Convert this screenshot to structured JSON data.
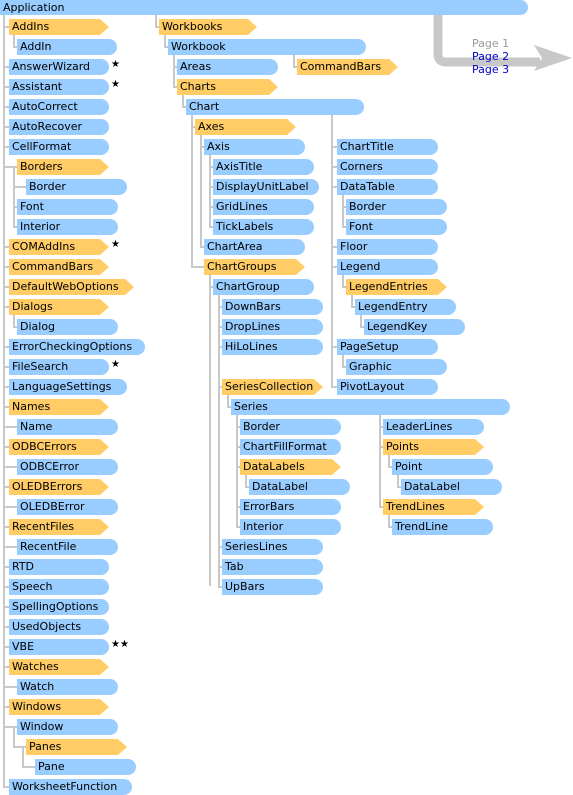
{
  "diagram": {
    "root": "Application",
    "colors": {
      "object": "#99ccff",
      "collection": "#ffcc66",
      "connector": "#c8c8c8",
      "link": "#0000cc",
      "current_page": "#999999"
    },
    "legend_markers": {
      "star": "★",
      "double_star": "★★"
    },
    "nodes": [
      {
        "id": "addins",
        "label": "AddIns",
        "type": "collection"
      },
      {
        "id": "addin",
        "label": "AddIn",
        "type": "object"
      },
      {
        "id": "answerwizard",
        "label": "AnswerWizard",
        "type": "object",
        "marker": "★"
      },
      {
        "id": "assistant",
        "label": "Assistant",
        "type": "object",
        "marker": "★"
      },
      {
        "id": "autocorrect",
        "label": "AutoCorrect",
        "type": "object"
      },
      {
        "id": "autorecover",
        "label": "AutoRecover",
        "type": "object"
      },
      {
        "id": "cellformat",
        "label": "CellFormat",
        "type": "object"
      },
      {
        "id": "cf-borders",
        "label": "Borders",
        "type": "collection"
      },
      {
        "id": "cf-border",
        "label": "Border",
        "type": "object"
      },
      {
        "id": "cf-font",
        "label": "Font",
        "type": "object"
      },
      {
        "id": "cf-interior",
        "label": "Interior",
        "type": "object"
      },
      {
        "id": "comaddins",
        "label": "COMAddIns",
        "type": "collection",
        "marker": "★"
      },
      {
        "id": "commandbars",
        "label": "CommandBars",
        "type": "collection"
      },
      {
        "id": "defaultweboptions",
        "label": "DefaultWebOptions",
        "type": "collection"
      },
      {
        "id": "dialogs",
        "label": "Dialogs",
        "type": "collection"
      },
      {
        "id": "dialog",
        "label": "Dialog",
        "type": "object"
      },
      {
        "id": "errorcheckingoptions",
        "label": "ErrorCheckingOptions",
        "type": "object"
      },
      {
        "id": "filesearch",
        "label": "FileSearch",
        "type": "object",
        "marker": "★"
      },
      {
        "id": "languagesettings",
        "label": "LanguageSettings",
        "type": "object"
      },
      {
        "id": "names",
        "label": "Names",
        "type": "collection"
      },
      {
        "id": "name",
        "label": "Name",
        "type": "object"
      },
      {
        "id": "odbcerrors",
        "label": "ODBCErrors",
        "type": "collection"
      },
      {
        "id": "odbcerror",
        "label": "ODBCError",
        "type": "object"
      },
      {
        "id": "oledberrors",
        "label": "OLEDBErrors",
        "type": "collection"
      },
      {
        "id": "oledberror",
        "label": "OLEDBError",
        "type": "object"
      },
      {
        "id": "recentfiles",
        "label": "RecentFiles",
        "type": "collection"
      },
      {
        "id": "recentfile",
        "label": "RecentFile",
        "type": "object"
      },
      {
        "id": "rtd",
        "label": "RTD",
        "type": "object"
      },
      {
        "id": "speech",
        "label": "Speech",
        "type": "object"
      },
      {
        "id": "spellingoptions",
        "label": "SpellingOptions",
        "type": "object"
      },
      {
        "id": "usedobjects",
        "label": "UsedObjects",
        "type": "object"
      },
      {
        "id": "vbe",
        "label": "VBE",
        "type": "object",
        "marker": "★★"
      },
      {
        "id": "watches",
        "label": "Watches",
        "type": "collection"
      },
      {
        "id": "watch",
        "label": "Watch",
        "type": "object"
      },
      {
        "id": "windows",
        "label": "Windows",
        "type": "collection"
      },
      {
        "id": "window",
        "label": "Window",
        "type": "object"
      },
      {
        "id": "panes",
        "label": "Panes",
        "type": "collection"
      },
      {
        "id": "pane",
        "label": "Pane",
        "type": "object"
      },
      {
        "id": "worksheetfunction",
        "label": "WorksheetFunction",
        "type": "object"
      },
      {
        "id": "workbooks",
        "label": "Workbooks",
        "type": "collection"
      },
      {
        "id": "workbook",
        "label": "Workbook",
        "type": "object"
      },
      {
        "id": "areas",
        "label": "Areas",
        "type": "object"
      },
      {
        "id": "wb-commandbars",
        "label": "CommandBars",
        "type": "collection"
      },
      {
        "id": "charts",
        "label": "Charts",
        "type": "collection"
      },
      {
        "id": "chart",
        "label": "Chart",
        "type": "object"
      },
      {
        "id": "axes",
        "label": "Axes",
        "type": "collection"
      },
      {
        "id": "axis",
        "label": "Axis",
        "type": "object"
      },
      {
        "id": "axistitle",
        "label": "AxisTitle",
        "type": "object"
      },
      {
        "id": "displayunitlabel",
        "label": "DisplayUnitLabel",
        "type": "object"
      },
      {
        "id": "gridlines",
        "label": "GridLines",
        "type": "object"
      },
      {
        "id": "ticklabels",
        "label": "TickLabels",
        "type": "object"
      },
      {
        "id": "chartarea",
        "label": "ChartArea",
        "type": "object"
      },
      {
        "id": "chartgroups",
        "label": "ChartGroups",
        "type": "collection"
      },
      {
        "id": "chartgroup",
        "label": "ChartGroup",
        "type": "object"
      },
      {
        "id": "downbars",
        "label": "DownBars",
        "type": "object"
      },
      {
        "id": "droplines",
        "label": "DropLines",
        "type": "object"
      },
      {
        "id": "hilolines",
        "label": "HiLoLines",
        "type": "object"
      },
      {
        "id": "seriescollection",
        "label": "SeriesCollection",
        "type": "collection"
      },
      {
        "id": "series",
        "label": "Series",
        "type": "object"
      },
      {
        "id": "s-border",
        "label": "Border",
        "type": "object"
      },
      {
        "id": "chartfillformat",
        "label": "ChartFillFormat",
        "type": "object"
      },
      {
        "id": "datalabels",
        "label": "DataLabels",
        "type": "collection"
      },
      {
        "id": "datalabel",
        "label": "DataLabel",
        "type": "object"
      },
      {
        "id": "errorbars",
        "label": "ErrorBars",
        "type": "object"
      },
      {
        "id": "s-interior",
        "label": "Interior",
        "type": "object"
      },
      {
        "id": "leaderlines",
        "label": "LeaderLines",
        "type": "object"
      },
      {
        "id": "points",
        "label": "Points",
        "type": "collection"
      },
      {
        "id": "point",
        "label": "Point",
        "type": "object"
      },
      {
        "id": "p-datalabel",
        "label": "DataLabel",
        "type": "object"
      },
      {
        "id": "trendlines",
        "label": "TrendLines",
        "type": "collection"
      },
      {
        "id": "trendline",
        "label": "TrendLine",
        "type": "object"
      },
      {
        "id": "serieslines",
        "label": "SeriesLines",
        "type": "object"
      },
      {
        "id": "tab",
        "label": "Tab",
        "type": "object"
      },
      {
        "id": "upbars",
        "label": "UpBars",
        "type": "object"
      },
      {
        "id": "charttitle",
        "label": "ChartTitle",
        "type": "object"
      },
      {
        "id": "corners",
        "label": "Corners",
        "type": "object"
      },
      {
        "id": "datatable",
        "label": "DataTable",
        "type": "object"
      },
      {
        "id": "dt-border",
        "label": "Border",
        "type": "object"
      },
      {
        "id": "dt-font",
        "label": "Font",
        "type": "object"
      },
      {
        "id": "floor",
        "label": "Floor",
        "type": "object"
      },
      {
        "id": "legend",
        "label": "Legend",
        "type": "object"
      },
      {
        "id": "legendentries",
        "label": "LegendEntries",
        "type": "collection"
      },
      {
        "id": "legendentry",
        "label": "LegendEntry",
        "type": "object"
      },
      {
        "id": "legendkey",
        "label": "LegendKey",
        "type": "object"
      },
      {
        "id": "pagesetup",
        "label": "PageSetup",
        "type": "object"
      },
      {
        "id": "graphic",
        "label": "Graphic",
        "type": "object"
      },
      {
        "id": "pivotlayout",
        "label": "PivotLayout",
        "type": "object"
      }
    ]
  },
  "page_nav": {
    "current": 1,
    "pages": [
      {
        "label": "Page 1",
        "current": true
      },
      {
        "label": "Page 2",
        "current": false
      },
      {
        "label": "Page 3",
        "current": false
      }
    ]
  }
}
